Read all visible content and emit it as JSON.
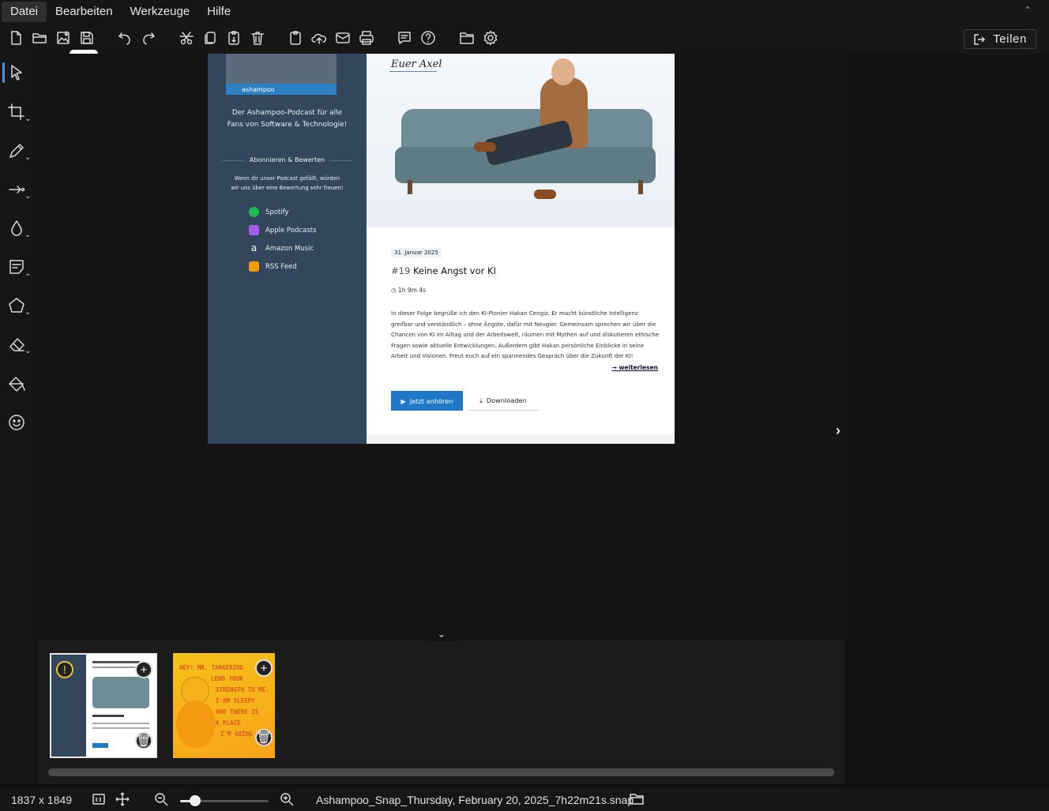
{
  "menu": {
    "items": [
      "Datei",
      "Bearbeiten",
      "Werkzeuge",
      "Hilfe"
    ]
  },
  "toolbar": {
    "share_label": "Teilen",
    "icons": [
      "new-file-icon",
      "open-folder-icon",
      "save-image-icon",
      "save-icon",
      "undo-icon",
      "redo-icon",
      "cut-icon",
      "copy-icon",
      "paste-icon",
      "delete-icon",
      "clipboard-icon",
      "cloud-upload-icon",
      "mail-icon",
      "print-icon",
      "comment-icon",
      "help-icon",
      "folder-icon",
      "settings-icon"
    ]
  },
  "tools": [
    "select-tool-icon",
    "crop-tool-icon",
    "pen-tool-icon",
    "arrow-tool-icon",
    "blur-tool-icon",
    "text-tool-icon",
    "shape-tool-icon",
    "eraser-tool-icon",
    "fill-tool-icon",
    "emoji-tool-icon"
  ],
  "capture": {
    "brand": "ashampoo",
    "tagline_1": "Der Ashampoo-Podcast für alle",
    "tagline_2": "Fans von Software & Technologie!",
    "subscribe_heading": "Abonnieren & Bewerten",
    "subscribe_text_1": "Wenn dir unser Podcast gefällt, würden",
    "subscribe_text_2": "wir uns über eine Bewertung sehr freuen!",
    "links": [
      {
        "label": "Spotify",
        "color": "#1db954"
      },
      {
        "label": "Apple Podcasts",
        "color": "#a45de8"
      },
      {
        "label": "Amazon Music",
        "color": "#33475c"
      },
      {
        "label": "RSS Feed",
        "color": "#f39c12"
      }
    ],
    "signature": "Euer Axel",
    "date": "31. Januar 2025",
    "episode_number": "#19",
    "episode_title": "Keine Angst vor KI",
    "duration": "1h 9m 4s",
    "description": "In dieser Folge begrüße ich den KI-Pionier Hakan Cengiz. Er macht künstliche Intelligenz greifbar und verständlich – ohne Ängste, dafür mit Neugier. Gemeinsam sprechen wir über die Chancen von KI im Alltag und der Arbeitswelt, räumen mit Mythen auf und diskutieren ethische Fragen sowie aktuelle Entwicklungen. Außerdem gibt Hakan persönliche Einblicke in seine Arbeit und Visionen. Freut euch auf ein spannendes Gespräch über die Zukunft der KI!",
    "read_more": "weiterlesen",
    "listen_label": "Jetzt anhören",
    "download_label": "Downloaden"
  },
  "filmstrip": {
    "thumb2_lines": [
      "HEY! MR. TANGERINE",
      "LEND YOUR",
      "STRENGTH TO ME.",
      "I AM SLEEPY",
      "AND THERE IS",
      "A PLACE",
      "I'M GOING"
    ]
  },
  "status": {
    "dimensions": "1837 x 1849",
    "zoom_fraction": 0.17,
    "filename": "Ashampoo_Snap_Thursday, February 20, 2025_7h22m21s.snap"
  }
}
